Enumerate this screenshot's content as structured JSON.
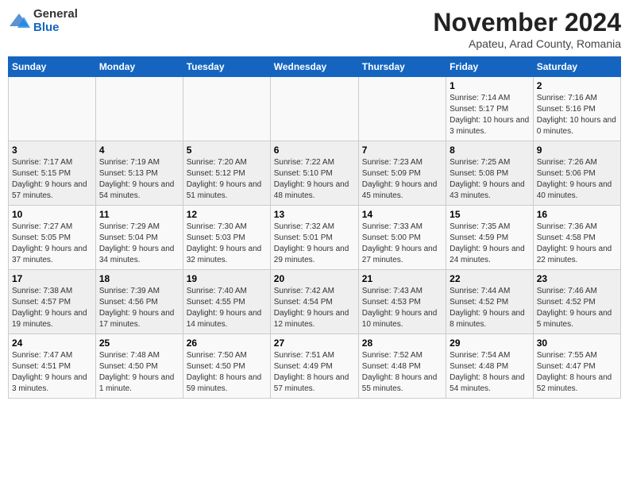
{
  "logo": {
    "general": "General",
    "blue": "Blue"
  },
  "title": "November 2024",
  "location": "Apateu, Arad County, Romania",
  "days_of_week": [
    "Sunday",
    "Monday",
    "Tuesday",
    "Wednesday",
    "Thursday",
    "Friday",
    "Saturday"
  ],
  "weeks": [
    [
      {
        "day": "",
        "info": ""
      },
      {
        "day": "",
        "info": ""
      },
      {
        "day": "",
        "info": ""
      },
      {
        "day": "",
        "info": ""
      },
      {
        "day": "",
        "info": ""
      },
      {
        "day": "1",
        "info": "Sunrise: 7:14 AM\nSunset: 5:17 PM\nDaylight: 10 hours and 3 minutes."
      },
      {
        "day": "2",
        "info": "Sunrise: 7:16 AM\nSunset: 5:16 PM\nDaylight: 10 hours and 0 minutes."
      }
    ],
    [
      {
        "day": "3",
        "info": "Sunrise: 7:17 AM\nSunset: 5:15 PM\nDaylight: 9 hours and 57 minutes."
      },
      {
        "day": "4",
        "info": "Sunrise: 7:19 AM\nSunset: 5:13 PM\nDaylight: 9 hours and 54 minutes."
      },
      {
        "day": "5",
        "info": "Sunrise: 7:20 AM\nSunset: 5:12 PM\nDaylight: 9 hours and 51 minutes."
      },
      {
        "day": "6",
        "info": "Sunrise: 7:22 AM\nSunset: 5:10 PM\nDaylight: 9 hours and 48 minutes."
      },
      {
        "day": "7",
        "info": "Sunrise: 7:23 AM\nSunset: 5:09 PM\nDaylight: 9 hours and 45 minutes."
      },
      {
        "day": "8",
        "info": "Sunrise: 7:25 AM\nSunset: 5:08 PM\nDaylight: 9 hours and 43 minutes."
      },
      {
        "day": "9",
        "info": "Sunrise: 7:26 AM\nSunset: 5:06 PM\nDaylight: 9 hours and 40 minutes."
      }
    ],
    [
      {
        "day": "10",
        "info": "Sunrise: 7:27 AM\nSunset: 5:05 PM\nDaylight: 9 hours and 37 minutes."
      },
      {
        "day": "11",
        "info": "Sunrise: 7:29 AM\nSunset: 5:04 PM\nDaylight: 9 hours and 34 minutes."
      },
      {
        "day": "12",
        "info": "Sunrise: 7:30 AM\nSunset: 5:03 PM\nDaylight: 9 hours and 32 minutes."
      },
      {
        "day": "13",
        "info": "Sunrise: 7:32 AM\nSunset: 5:01 PM\nDaylight: 9 hours and 29 minutes."
      },
      {
        "day": "14",
        "info": "Sunrise: 7:33 AM\nSunset: 5:00 PM\nDaylight: 9 hours and 27 minutes."
      },
      {
        "day": "15",
        "info": "Sunrise: 7:35 AM\nSunset: 4:59 PM\nDaylight: 9 hours and 24 minutes."
      },
      {
        "day": "16",
        "info": "Sunrise: 7:36 AM\nSunset: 4:58 PM\nDaylight: 9 hours and 22 minutes."
      }
    ],
    [
      {
        "day": "17",
        "info": "Sunrise: 7:38 AM\nSunset: 4:57 PM\nDaylight: 9 hours and 19 minutes."
      },
      {
        "day": "18",
        "info": "Sunrise: 7:39 AM\nSunset: 4:56 PM\nDaylight: 9 hours and 17 minutes."
      },
      {
        "day": "19",
        "info": "Sunrise: 7:40 AM\nSunset: 4:55 PM\nDaylight: 9 hours and 14 minutes."
      },
      {
        "day": "20",
        "info": "Sunrise: 7:42 AM\nSunset: 4:54 PM\nDaylight: 9 hours and 12 minutes."
      },
      {
        "day": "21",
        "info": "Sunrise: 7:43 AM\nSunset: 4:53 PM\nDaylight: 9 hours and 10 minutes."
      },
      {
        "day": "22",
        "info": "Sunrise: 7:44 AM\nSunset: 4:52 PM\nDaylight: 9 hours and 8 minutes."
      },
      {
        "day": "23",
        "info": "Sunrise: 7:46 AM\nSunset: 4:52 PM\nDaylight: 9 hours and 5 minutes."
      }
    ],
    [
      {
        "day": "24",
        "info": "Sunrise: 7:47 AM\nSunset: 4:51 PM\nDaylight: 9 hours and 3 minutes."
      },
      {
        "day": "25",
        "info": "Sunrise: 7:48 AM\nSunset: 4:50 PM\nDaylight: 9 hours and 1 minute."
      },
      {
        "day": "26",
        "info": "Sunrise: 7:50 AM\nSunset: 4:50 PM\nDaylight: 8 hours and 59 minutes."
      },
      {
        "day": "27",
        "info": "Sunrise: 7:51 AM\nSunset: 4:49 PM\nDaylight: 8 hours and 57 minutes."
      },
      {
        "day": "28",
        "info": "Sunrise: 7:52 AM\nSunset: 4:48 PM\nDaylight: 8 hours and 55 minutes."
      },
      {
        "day": "29",
        "info": "Sunrise: 7:54 AM\nSunset: 4:48 PM\nDaylight: 8 hours and 54 minutes."
      },
      {
        "day": "30",
        "info": "Sunrise: 7:55 AM\nSunset: 4:47 PM\nDaylight: 8 hours and 52 minutes."
      }
    ]
  ]
}
